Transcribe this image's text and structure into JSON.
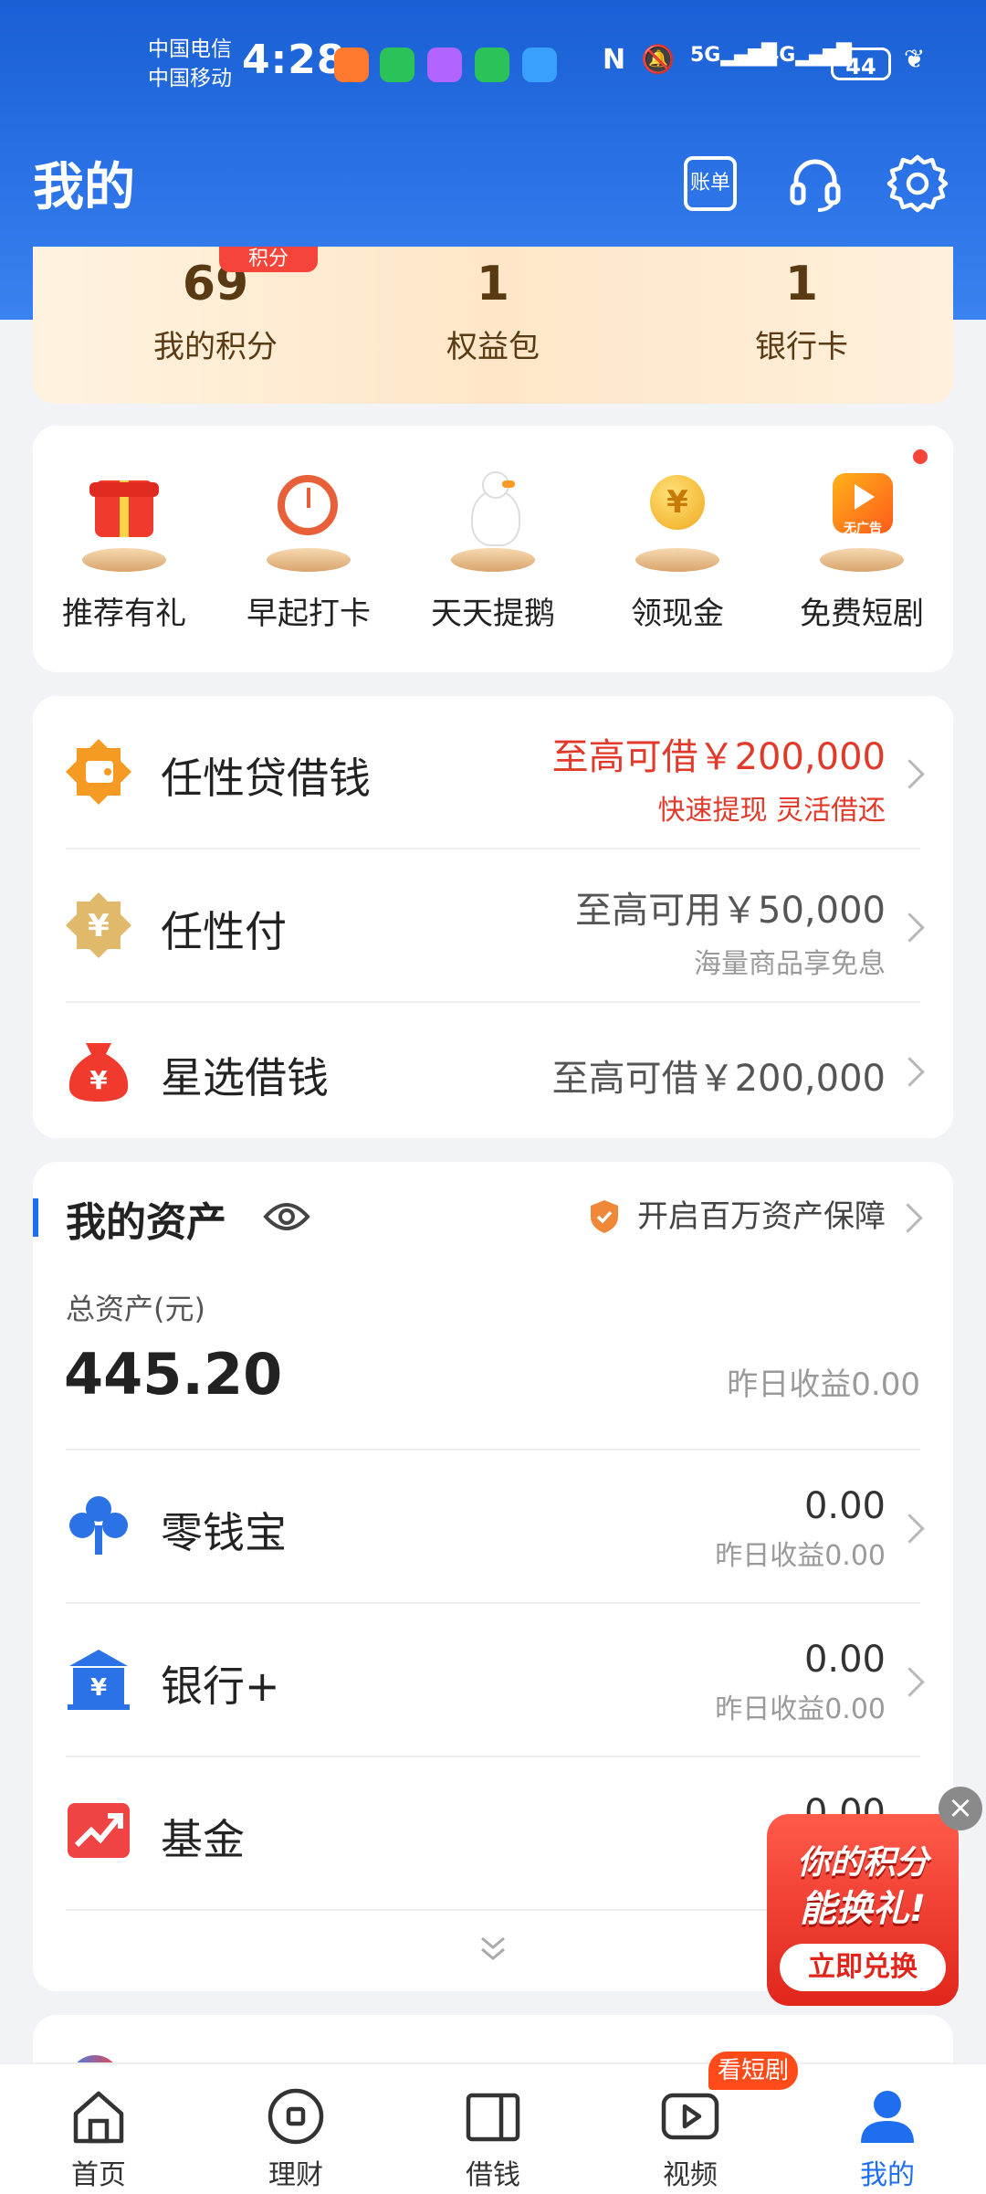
{
  "status_bar": {
    "carrier1": "中国电信",
    "carrier2": "中国移动",
    "time": "4:28",
    "net1": "5G",
    "net2": "4G",
    "battery": "44"
  },
  "header": {
    "title": "我的",
    "bill_label": "账单"
  },
  "points": {
    "badge": "积分",
    "items": [
      {
        "value": "69",
        "label": "我的积分"
      },
      {
        "value": "1",
        "label": "权益包"
      },
      {
        "value": "1",
        "label": "银行卡"
      }
    ]
  },
  "shortcuts": [
    {
      "label": "推荐有礼"
    },
    {
      "label": "早起打卡"
    },
    {
      "label": "天天提鹅"
    },
    {
      "label": "领现金"
    },
    {
      "label": "免费短剧",
      "icon_text": "无广告"
    }
  ],
  "loans": [
    {
      "title": "任性贷借钱",
      "main": "至高可借￥200,000",
      "sub": "快速提现 灵活借还"
    },
    {
      "title": "任性付",
      "main": "至高可用￥50,000",
      "sub": "海量商品享免息"
    },
    {
      "title": "星选借钱",
      "main": "至高可借￥200,000"
    }
  ],
  "assets": {
    "title": "我的资产",
    "protection": "开启百万资产保障",
    "total_label": "总资产(元)",
    "total_value": "445.20",
    "yesterday": "昨日收益0.00",
    "items": [
      {
        "title": "零钱宝",
        "value": "0.00",
        "sub": "昨日收益0.00"
      },
      {
        "title": "银行+",
        "value": "0.00",
        "sub": "昨日收益0.00"
      },
      {
        "title": "基金",
        "value": "0.00",
        "sub": "昨日"
      }
    ]
  },
  "float_ad": {
    "line1": "你的积分",
    "line2": "能换礼!",
    "button": "立即兑换"
  },
  "nav": {
    "items": [
      {
        "label": "首页"
      },
      {
        "label": "理财"
      },
      {
        "label": "借钱"
      },
      {
        "label": "视频",
        "badge": "看短剧"
      },
      {
        "label": "我的"
      }
    ]
  },
  "colors": {
    "brand_blue": "#1f6ef0",
    "accent_red": "#e03a2a"
  }
}
